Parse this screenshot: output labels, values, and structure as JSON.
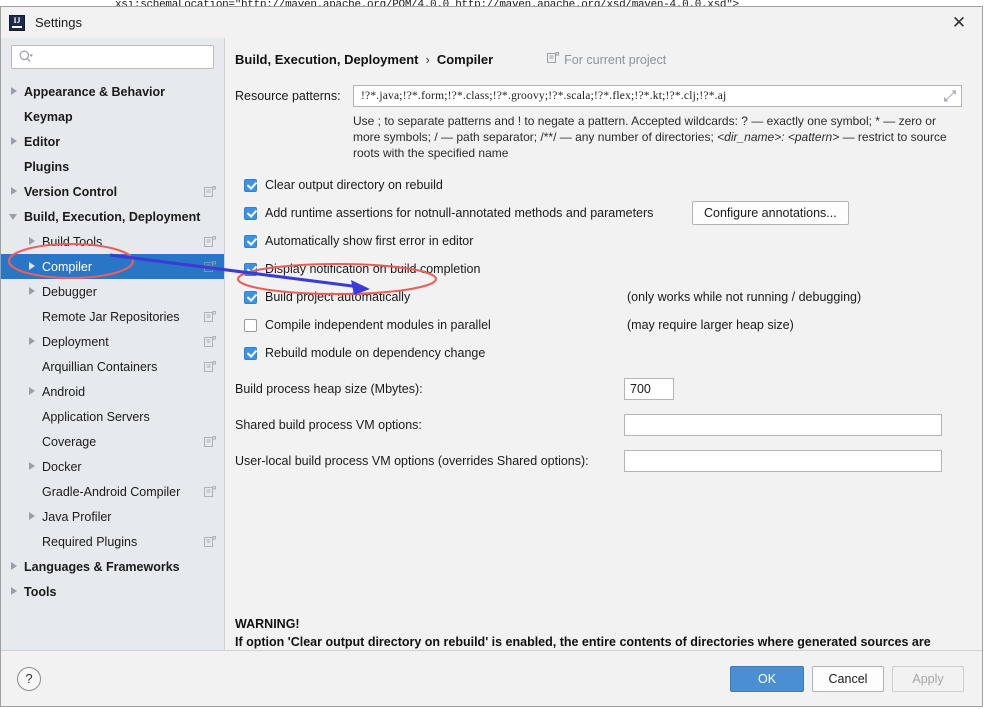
{
  "background_code": "xsi:schemaLocation=\"http://maven.apache.org/POM/4.0.0 http://maven.apache.org/xsd/maven-4.0.0.xsd\">",
  "window": {
    "title": "Settings",
    "app_icon": "intellij-idea-icon",
    "close_icon": "close-icon"
  },
  "sidebar": {
    "search": {
      "icon": "search-icon",
      "value": "",
      "placeholder": ""
    },
    "items": [
      {
        "label": "Appearance & Behavior",
        "level": 0,
        "bold": true,
        "arrow": "right",
        "project_icon": false,
        "selected": false
      },
      {
        "label": "Keymap",
        "level": 0,
        "bold": true,
        "arrow": "none",
        "project_icon": false,
        "selected": false
      },
      {
        "label": "Editor",
        "level": 0,
        "bold": true,
        "arrow": "right",
        "project_icon": false,
        "selected": false
      },
      {
        "label": "Plugins",
        "level": 0,
        "bold": true,
        "arrow": "none",
        "project_icon": false,
        "selected": false
      },
      {
        "label": "Version Control",
        "level": 0,
        "bold": true,
        "arrow": "right",
        "project_icon": true,
        "selected": false
      },
      {
        "label": "Build, Execution, Deployment",
        "level": 0,
        "bold": true,
        "arrow": "down",
        "project_icon": false,
        "selected": false
      },
      {
        "label": "Build Tools",
        "level": 1,
        "bold": false,
        "arrow": "right",
        "project_icon": true,
        "selected": false
      },
      {
        "label": "Compiler",
        "level": 1,
        "bold": false,
        "arrow": "right",
        "project_icon": true,
        "selected": true
      },
      {
        "label": "Debugger",
        "level": 1,
        "bold": false,
        "arrow": "right",
        "project_icon": false,
        "selected": false
      },
      {
        "label": "Remote Jar Repositories",
        "level": 1,
        "bold": false,
        "arrow": "none",
        "project_icon": true,
        "selected": false
      },
      {
        "label": "Deployment",
        "level": 1,
        "bold": false,
        "arrow": "right",
        "project_icon": true,
        "selected": false
      },
      {
        "label": "Arquillian Containers",
        "level": 1,
        "bold": false,
        "arrow": "none",
        "project_icon": true,
        "selected": false
      },
      {
        "label": "Android",
        "level": 1,
        "bold": false,
        "arrow": "right",
        "project_icon": false,
        "selected": false
      },
      {
        "label": "Application Servers",
        "level": 1,
        "bold": false,
        "arrow": "none",
        "project_icon": false,
        "selected": false
      },
      {
        "label": "Coverage",
        "level": 1,
        "bold": false,
        "arrow": "none",
        "project_icon": true,
        "selected": false
      },
      {
        "label": "Docker",
        "level": 1,
        "bold": false,
        "arrow": "right",
        "project_icon": false,
        "selected": false
      },
      {
        "label": "Gradle-Android Compiler",
        "level": 1,
        "bold": false,
        "arrow": "none",
        "project_icon": true,
        "selected": false
      },
      {
        "label": "Java Profiler",
        "level": 1,
        "bold": false,
        "arrow": "right",
        "project_icon": false,
        "selected": false
      },
      {
        "label": "Required Plugins",
        "level": 1,
        "bold": false,
        "arrow": "none",
        "project_icon": true,
        "selected": false
      },
      {
        "label": "Languages & Frameworks",
        "level": 0,
        "bold": true,
        "arrow": "right",
        "project_icon": false,
        "selected": false
      },
      {
        "label": "Tools",
        "level": 0,
        "bold": true,
        "arrow": "right",
        "project_icon": false,
        "selected": false
      }
    ]
  },
  "main": {
    "breadcrumb": {
      "root": "Build, Execution, Deployment",
      "separator": "›",
      "current": "Compiler"
    },
    "scope_badge": {
      "icon": "project-scope-icon",
      "label": "For current project"
    },
    "resource_patterns": {
      "label": "Resource patterns:",
      "value": "!?*.java;!?*.form;!?*.class;!?*.groovy;!?*.scala;!?*.flex;!?*.kt;!?*.clj;!?*.aj",
      "expand_icon": "expand-icon"
    },
    "hint": "Use ; to separate patterns and ! to negate a pattern. Accepted wildcards: ? — exactly one symbol; * — zero or more symbols; / — path separator; /**/ — any number of directories;  <dir_name>: <pattern> — restrict to source roots with the specified name",
    "hint_italic_1": "<dir_name>: <pattern>",
    "checkboxes": [
      {
        "label": "Clear output directory on rebuild",
        "checked": true,
        "note": "",
        "button": ""
      },
      {
        "label": "Add runtime assertions for notnull-annotated methods and parameters",
        "checked": true,
        "note": "",
        "button": "Configure annotations..."
      },
      {
        "label": "Automatically show first error in editor",
        "checked": true,
        "note": "",
        "button": ""
      },
      {
        "label": "Display notification on build completion",
        "checked": true,
        "note": "",
        "button": ""
      },
      {
        "label": "Build project automatically",
        "checked": true,
        "note": "(only works while not running / debugging)",
        "button": ""
      },
      {
        "label": "Compile independent modules in parallel",
        "checked": false,
        "note": "(may require larger heap size)",
        "button": ""
      },
      {
        "label": "Rebuild module on dependency change",
        "checked": true,
        "note": "",
        "button": ""
      }
    ],
    "fields": [
      {
        "label": "Build process heap size (Mbytes):",
        "value": "700",
        "wide": false
      },
      {
        "label": "Shared build process VM options:",
        "value": "",
        "wide": true
      },
      {
        "label": "User-local build process VM options (overrides Shared options):",
        "value": "",
        "wide": true
      }
    ],
    "warning": {
      "heading": "WARNING!",
      "body": "If option 'Clear output directory on rebuild' is enabled, the entire contents of directories where generated sources are stored WILL BE CLEARED on rebuild."
    }
  },
  "footer": {
    "help_label": "?",
    "ok_label": "OK",
    "cancel_label": "Cancel",
    "apply_label": "Apply"
  },
  "annotations": {
    "ellipse_color": "#e8605c",
    "arrow_color": "#3b3bd6"
  },
  "colors": {
    "selection_blue": "#2a76c6",
    "checkbox_blue": "#3b93e8",
    "primary_button": "#4a8fd4",
    "sidebar_bg": "#e6eaef",
    "panel_bg": "#f2f2f2"
  }
}
